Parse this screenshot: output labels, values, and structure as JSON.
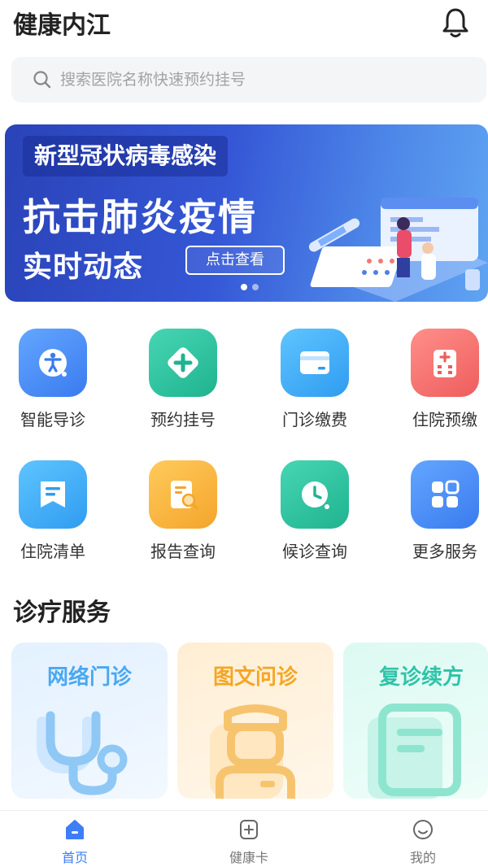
{
  "header": {
    "title": "健康内江",
    "notification_icon": "bell-icon"
  },
  "search": {
    "placeholder": "搜索医院名称快速预约挂号",
    "icon": "search-icon"
  },
  "banner": {
    "tag": "新型冠状病毒感染",
    "headline": "抗击肺炎疫情",
    "subheadline": "实时动态",
    "button_label": "点击查看",
    "page_count": 2,
    "active_page": 1
  },
  "services": [
    {
      "label": "智能导诊",
      "icon": "accessibility-icon",
      "color": "#4a8ef5"
    },
    {
      "label": "预约挂号",
      "icon": "plus-diamond-icon",
      "color": "#2fc3a0"
    },
    {
      "label": "门诊缴费",
      "icon": "card-icon",
      "color": "#3fa9f5"
    },
    {
      "label": "住院预缴",
      "icon": "hospital-icon",
      "color": "#f06e6e"
    },
    {
      "label": "住院清单",
      "icon": "list-doc-icon",
      "color": "#3fa9f5"
    },
    {
      "label": "报告查询",
      "icon": "report-search-icon",
      "color": "#f7b240"
    },
    {
      "label": "候诊查询",
      "icon": "clock-icon",
      "color": "#2fc3a0"
    },
    {
      "label": "更多服务",
      "icon": "grid-icon",
      "color": "#4a8ef5"
    }
  ],
  "section": {
    "title": "诊疗服务"
  },
  "cards": [
    {
      "title": "网络门诊",
      "icon": "stethoscope-icon",
      "color": "#4aa8f0",
      "bg": "#e8f3ff"
    },
    {
      "title": "图文问诊",
      "icon": "doctor-icon",
      "color": "#f5a623",
      "bg": "#fff3e0"
    },
    {
      "title": "复诊续方",
      "icon": "prescription-icon",
      "color": "#2fc3a8",
      "bg": "#e3faf5"
    }
  ],
  "tabbar": [
    {
      "label": "首页",
      "icon": "home-icon",
      "active": true
    },
    {
      "label": "健康卡",
      "icon": "health-card-icon",
      "active": false
    },
    {
      "label": "我的",
      "icon": "smile-icon",
      "active": false
    }
  ],
  "colors": {
    "accent": "#3d7ef5",
    "tab_inactive": "#777777"
  }
}
